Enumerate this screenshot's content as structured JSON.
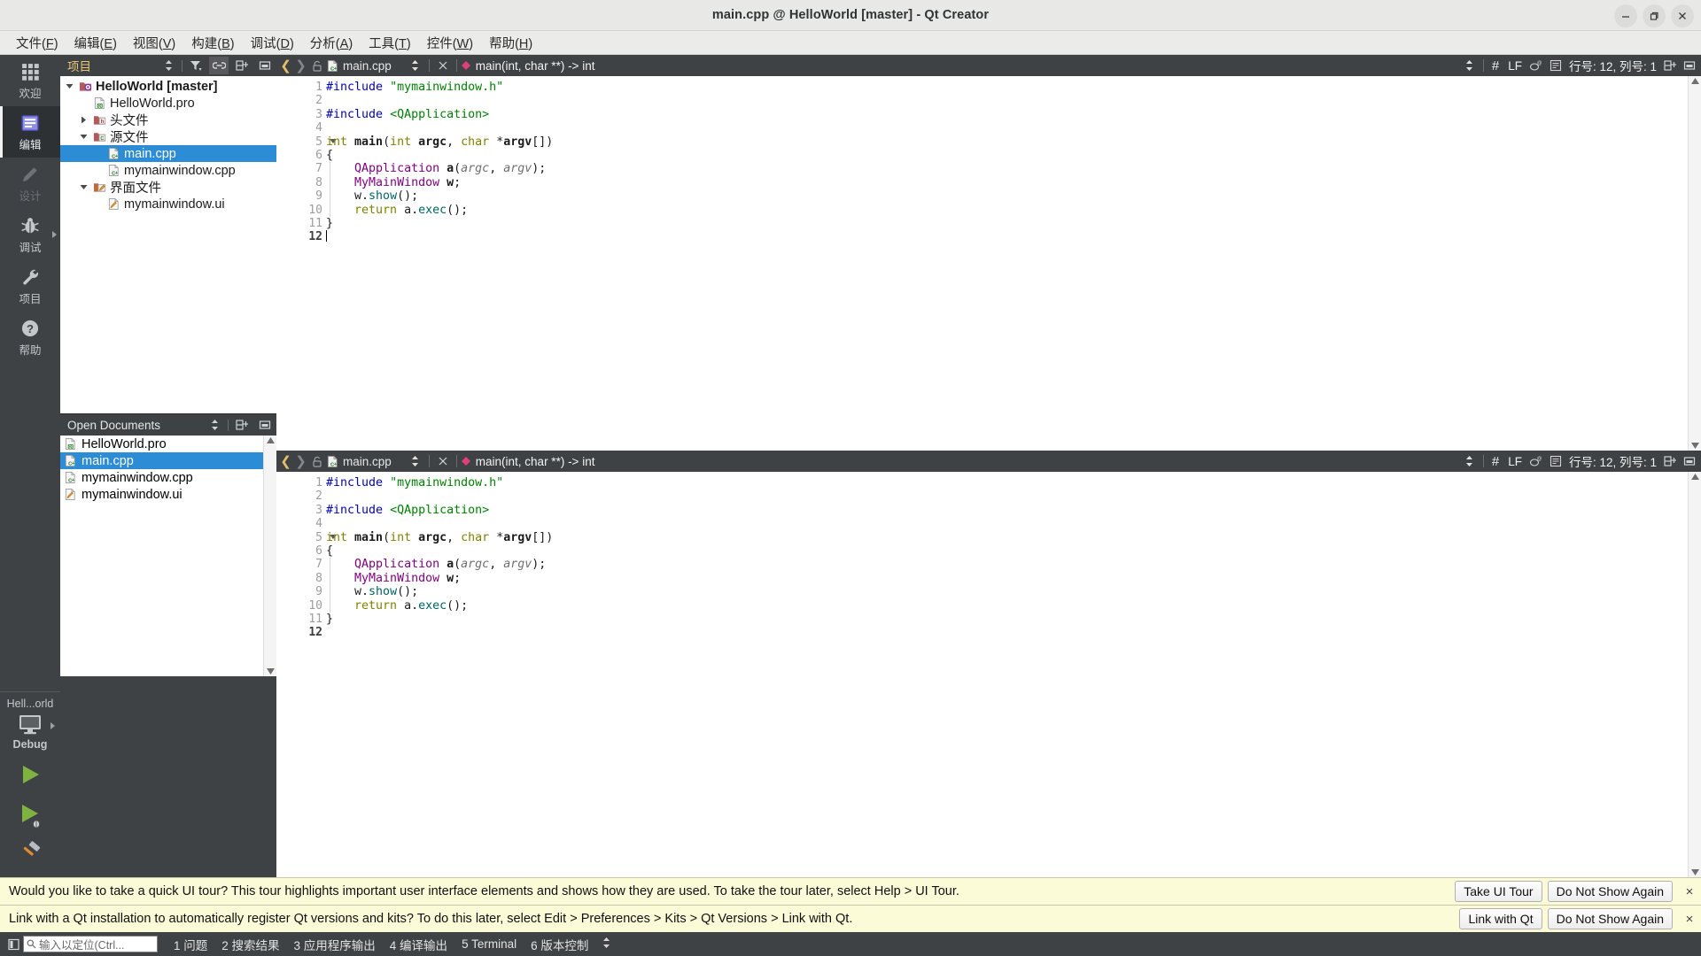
{
  "window": {
    "title": "main.cpp @ HelloWorld [master] - Qt Creator",
    "minimize": "minimize",
    "maximize": "restore",
    "close": "close"
  },
  "menubar": [
    {
      "label": "文件(F)",
      "mnemonic": "F"
    },
    {
      "label": "编辑(E)",
      "mnemonic": "E"
    },
    {
      "label": "视图(V)",
      "mnemonic": "V"
    },
    {
      "label": "构建(B)",
      "mnemonic": "B"
    },
    {
      "label": "调试(D)",
      "mnemonic": "D"
    },
    {
      "label": "分析(A)",
      "mnemonic": "A"
    },
    {
      "label": "工具(T)",
      "mnemonic": "T"
    },
    {
      "label": "控件(W)",
      "mnemonic": "W"
    },
    {
      "label": "帮助(H)",
      "mnemonic": "H"
    }
  ],
  "modebar": {
    "modes": [
      {
        "label": "欢迎",
        "icon": "grid-icon",
        "state": "normal"
      },
      {
        "label": "编辑",
        "icon": "edit-document-icon",
        "state": "active"
      },
      {
        "label": "设计",
        "icon": "pencil-icon",
        "state": "disabled"
      },
      {
        "label": "调试",
        "icon": "bug-icon",
        "state": "normal"
      },
      {
        "label": "项目",
        "icon": "wrench-icon",
        "state": "normal"
      },
      {
        "label": "帮助",
        "icon": "question-circle-icon",
        "state": "normal"
      }
    ],
    "kit": {
      "project": "Hell...orld",
      "icon": "desktop-icon",
      "build_config": "Debug"
    },
    "run_buttons": [
      {
        "name": "run-button",
        "icon": "play-icon"
      },
      {
        "name": "debug-button",
        "icon": "play-bug-icon"
      },
      {
        "name": "build-button",
        "icon": "hammer-icon"
      }
    ]
  },
  "project_panel": {
    "title": "项目",
    "toolbar": [
      {
        "name": "sync-view-selector",
        "icon": "updown-arrows-icon"
      },
      {
        "name": "filter-button",
        "icon": "funnel-icon"
      },
      {
        "name": "link-with-editor-button",
        "icon": "chain-link-icon",
        "active": true
      },
      {
        "name": "split-button",
        "icon": "split-icon"
      },
      {
        "name": "close-sidebar-button",
        "icon": "close-pane-icon"
      }
    ],
    "tree": [
      {
        "label": "HelloWorld [master]",
        "icon": "qt-project-icon",
        "depth": 0,
        "twisty": "down",
        "bold": true,
        "selected": false
      },
      {
        "label": "HelloWorld.pro",
        "icon": "qt-pro-file-icon",
        "depth": 1,
        "twisty": "none",
        "bold": false,
        "selected": false
      },
      {
        "label": "头文件",
        "icon": "folder-h-icon",
        "depth": 1,
        "twisty": "right",
        "bold": false,
        "selected": false
      },
      {
        "label": "源文件",
        "icon": "folder-cpp-icon",
        "depth": 1,
        "twisty": "down",
        "bold": false,
        "selected": false
      },
      {
        "label": "main.cpp",
        "icon": "cpp-file-icon",
        "depth": 2,
        "twisty": "none",
        "bold": false,
        "selected": true
      },
      {
        "label": "mymainwindow.cpp",
        "icon": "cpp-file-icon",
        "depth": 2,
        "twisty": "none",
        "bold": false,
        "selected": false
      },
      {
        "label": "界面文件",
        "icon": "folder-ui-icon",
        "depth": 1,
        "twisty": "down",
        "bold": false,
        "selected": false
      },
      {
        "label": "mymainwindow.ui",
        "icon": "ui-file-icon",
        "depth": 2,
        "twisty": "none",
        "bold": false,
        "selected": false
      }
    ]
  },
  "open_documents": {
    "title": "Open Documents",
    "toolbar": [
      {
        "name": "sort-button",
        "icon": "updown-arrows-icon"
      },
      {
        "name": "split-button",
        "icon": "split-icon"
      },
      {
        "name": "close-pane-button",
        "icon": "close-pane-icon"
      }
    ],
    "items": [
      {
        "label": "HelloWorld.pro",
        "icon": "qt-pro-file-icon",
        "selected": false
      },
      {
        "label": "main.cpp",
        "icon": "cpp-file-icon",
        "selected": true
      },
      {
        "label": "mymainwindow.cpp",
        "icon": "cpp-file-icon",
        "selected": false
      },
      {
        "label": "mymainwindow.ui",
        "icon": "ui-file-icon",
        "selected": false
      }
    ]
  },
  "editors": [
    {
      "filename": "main.cpp",
      "symbol": "main(int, char **) -> int",
      "line_ending": "LF",
      "cursor": "行号: 12, 列号: 1",
      "lines": [
        {
          "n": "1",
          "fold": false,
          "tokens": [
            {
              "t": "#include ",
              "c": "k-pre"
            },
            {
              "t": "\"mymainwindow.h\"",
              "c": "k-str"
            }
          ]
        },
        {
          "n": "2",
          "fold": false,
          "tokens": []
        },
        {
          "n": "3",
          "fold": false,
          "tokens": [
            {
              "t": "#include ",
              "c": "k-pre"
            },
            {
              "t": "<QApplication>",
              "c": "k-inc"
            }
          ]
        },
        {
          "n": "4",
          "fold": false,
          "tokens": []
        },
        {
          "n": "5",
          "fold": true,
          "tokens": [
            {
              "t": "int ",
              "c": "k-kw"
            },
            {
              "t": "main",
              "c": "k-fn"
            },
            {
              "t": "(",
              "c": "k-punc"
            },
            {
              "t": "int ",
              "c": "k-kw"
            },
            {
              "t": "argc",
              "c": "k-var"
            },
            {
              "t": ", ",
              "c": "k-punc"
            },
            {
              "t": "char ",
              "c": "k-kw"
            },
            {
              "t": "*",
              "c": "k-punc"
            },
            {
              "t": "argv",
              "c": "k-var"
            },
            {
              "t": "[])",
              "c": "k-punc"
            }
          ]
        },
        {
          "n": "6",
          "fold": false,
          "tokens": [
            {
              "t": "{",
              "c": "k-punc"
            }
          ]
        },
        {
          "n": "7",
          "fold": false,
          "tokens": [
            {
              "t": "    ",
              "c": "k-punc"
            },
            {
              "t": "QApplication",
              "c": "k-type"
            },
            {
              "t": " ",
              "c": "k-punc"
            },
            {
              "t": "a",
              "c": "k-var"
            },
            {
              "t": "(",
              "c": "k-punc"
            },
            {
              "t": "argc",
              "c": "k-param"
            },
            {
              "t": ", ",
              "c": "k-punc"
            },
            {
              "t": "argv",
              "c": "k-param"
            },
            {
              "t": ");",
              "c": "k-punc"
            }
          ]
        },
        {
          "n": "8",
          "fold": false,
          "tokens": [
            {
              "t": "    ",
              "c": "k-punc"
            },
            {
              "t": "MyMainWindow",
              "c": "k-type"
            },
            {
              "t": " ",
              "c": "k-punc"
            },
            {
              "t": "w",
              "c": "k-var"
            },
            {
              "t": ";",
              "c": "k-punc"
            }
          ]
        },
        {
          "n": "9",
          "fold": false,
          "tokens": [
            {
              "t": "    w",
              "c": "k-punc"
            },
            {
              "t": ".",
              "c": "k-punc"
            },
            {
              "t": "show",
              "c": "k-mem"
            },
            {
              "t": "();",
              "c": "k-punc"
            }
          ]
        },
        {
          "n": "10",
          "fold": false,
          "tokens": [
            {
              "t": "    ",
              "c": "k-punc"
            },
            {
              "t": "return ",
              "c": "k-kw"
            },
            {
              "t": "a",
              "c": "k-punc"
            },
            {
              "t": ".",
              "c": "k-punc"
            },
            {
              "t": "exec",
              "c": "k-mem"
            },
            {
              "t": "();",
              "c": "k-punc"
            }
          ]
        },
        {
          "n": "11",
          "fold": false,
          "tokens": [
            {
              "t": "}",
              "c": "k-punc"
            }
          ]
        },
        {
          "n": "12",
          "fold": false,
          "current": true,
          "caret": true,
          "tokens": []
        }
      ]
    },
    {
      "filename": "main.cpp",
      "symbol": "main(int, char **) -> int",
      "line_ending": "LF",
      "cursor": "行号: 12, 列号: 1",
      "lines": [
        {
          "n": "1",
          "fold": false,
          "tokens": [
            {
              "t": "#include ",
              "c": "k-pre"
            },
            {
              "t": "\"mymainwindow.h\"",
              "c": "k-str"
            }
          ]
        },
        {
          "n": "2",
          "fold": false,
          "tokens": []
        },
        {
          "n": "3",
          "fold": false,
          "tokens": [
            {
              "t": "#include ",
              "c": "k-pre"
            },
            {
              "t": "<QApplication>",
              "c": "k-inc"
            }
          ]
        },
        {
          "n": "4",
          "fold": false,
          "tokens": []
        },
        {
          "n": "5",
          "fold": true,
          "tokens": [
            {
              "t": "int ",
              "c": "k-kw"
            },
            {
              "t": "main",
              "c": "k-fn"
            },
            {
              "t": "(",
              "c": "k-punc"
            },
            {
              "t": "int ",
              "c": "k-kw"
            },
            {
              "t": "argc",
              "c": "k-var"
            },
            {
              "t": ", ",
              "c": "k-punc"
            },
            {
              "t": "char ",
              "c": "k-kw"
            },
            {
              "t": "*",
              "c": "k-punc"
            },
            {
              "t": "argv",
              "c": "k-var"
            },
            {
              "t": "[])",
              "c": "k-punc"
            }
          ]
        },
        {
          "n": "6",
          "fold": false,
          "tokens": [
            {
              "t": "{",
              "c": "k-punc"
            }
          ]
        },
        {
          "n": "7",
          "fold": false,
          "tokens": [
            {
              "t": "    ",
              "c": "k-punc"
            },
            {
              "t": "QApplication",
              "c": "k-type"
            },
            {
              "t": " ",
              "c": "k-punc"
            },
            {
              "t": "a",
              "c": "k-var"
            },
            {
              "t": "(",
              "c": "k-punc"
            },
            {
              "t": "argc",
              "c": "k-param"
            },
            {
              "t": ", ",
              "c": "k-punc"
            },
            {
              "t": "argv",
              "c": "k-param"
            },
            {
              "t": ");",
              "c": "k-punc"
            }
          ]
        },
        {
          "n": "8",
          "fold": false,
          "tokens": [
            {
              "t": "    ",
              "c": "k-punc"
            },
            {
              "t": "MyMainWindow",
              "c": "k-type"
            },
            {
              "t": " ",
              "c": "k-punc"
            },
            {
              "t": "w",
              "c": "k-var"
            },
            {
              "t": ";",
              "c": "k-punc"
            }
          ]
        },
        {
          "n": "9",
          "fold": false,
          "tokens": [
            {
              "t": "    w",
              "c": "k-punc"
            },
            {
              "t": ".",
              "c": "k-punc"
            },
            {
              "t": "show",
              "c": "k-mem"
            },
            {
              "t": "();",
              "c": "k-punc"
            }
          ]
        },
        {
          "n": "10",
          "fold": false,
          "tokens": [
            {
              "t": "    ",
              "c": "k-punc"
            },
            {
              "t": "return ",
              "c": "k-kw"
            },
            {
              "t": "a",
              "c": "k-punc"
            },
            {
              "t": ".",
              "c": "k-punc"
            },
            {
              "t": "exec",
              "c": "k-mem"
            },
            {
              "t": "();",
              "c": "k-punc"
            }
          ]
        },
        {
          "n": "11",
          "fold": false,
          "tokens": [
            {
              "t": "}",
              "c": "k-punc"
            }
          ]
        },
        {
          "n": "12",
          "fold": false,
          "current": true,
          "caret": false,
          "tokens": []
        }
      ]
    }
  ],
  "notifications": [
    {
      "message": "Would you like to take a quick UI tour? This tour highlights important user interface elements and shows how they are used. To take the tour later, select Help > UI Tour.",
      "primary": "Take UI Tour",
      "secondary": "Do Not Show Again",
      "close": "×"
    },
    {
      "message": "Link with a Qt installation to automatically register Qt versions and kits? To do this later, select Edit > Preferences > Kits > Qt Versions > Link with Qt.",
      "primary": "Link with Qt",
      "secondary": "Do Not Show Again",
      "close": "×"
    }
  ],
  "statusbar": {
    "toggle_sidebar_icon": "sidebar-toggle-icon",
    "locator_placeholder": "输入以定位(Ctrl...",
    "locator_icon": "search-icon",
    "panes": [
      {
        "num": "1",
        "label": "问题"
      },
      {
        "num": "2",
        "label": "搜索结果"
      },
      {
        "num": "3",
        "label": "应用程序输出"
      },
      {
        "num": "4",
        "label": "编译输出"
      },
      {
        "num": "5",
        "label": "Terminal"
      },
      {
        "num": "6",
        "label": "版本控制"
      }
    ],
    "expand_icon": "updown-arrows-icon"
  },
  "colors": {
    "dark_chrome": "#3f4245",
    "mode_active": "#2e3134",
    "selection_blue": "#2c8cd6",
    "notification_bg": "#fbfbd8",
    "title_gold": "#e8c877",
    "run_green": "#7fb33f"
  }
}
